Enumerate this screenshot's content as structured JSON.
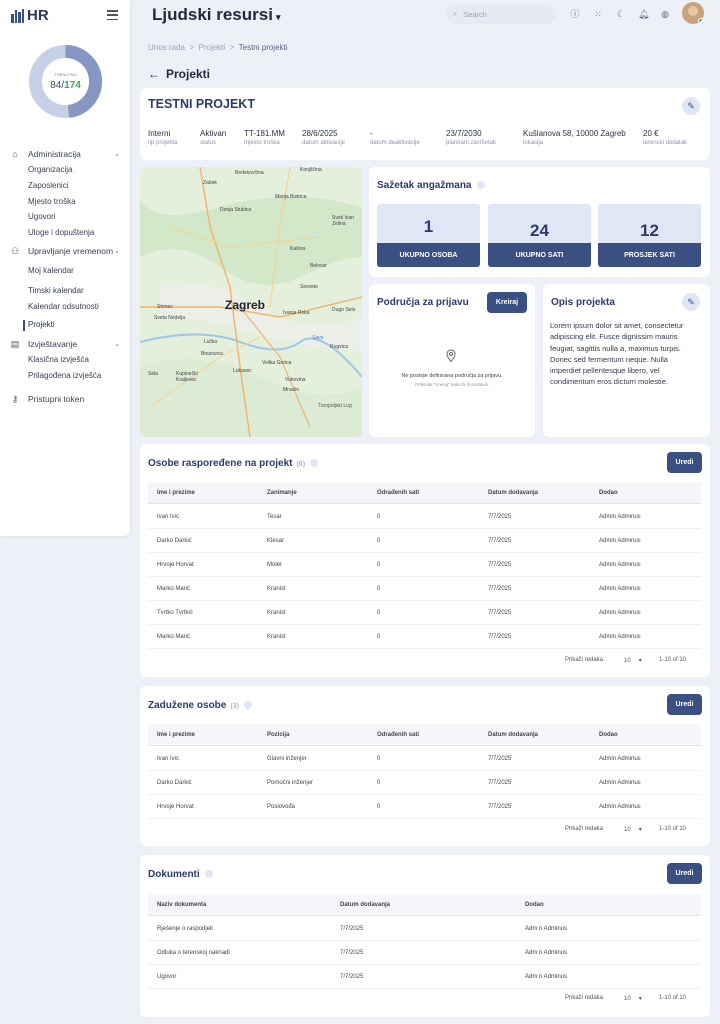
{
  "app": {
    "logo_text": "HR",
    "title": "Ljudski resursi",
    "title_caret": "▾"
  },
  "search": {
    "placeholder": "Search"
  },
  "donut": {
    "label": "TRENUTNO",
    "current": "84",
    "separator": "/",
    "total": "174"
  },
  "sidebar": {
    "sections": [
      {
        "label": "Administracija",
        "icon": "building-icon",
        "items": [
          "Organizacija",
          "Zaposlenici",
          "Mjesto troška",
          "Ugovori",
          "Uloge i dopuštenja"
        ]
      },
      {
        "label": "Upravljanje vremenom",
        "icon": "clock-people-icon",
        "items": [
          "Moj kalendar",
          "Timski kalendar",
          "Kalendar odsutnosti",
          "Projekti"
        ]
      },
      {
        "label": "Izvještavanje",
        "icon": "report-icon",
        "items": [
          "Klasična izvješća",
          "Prilagođena izvješća"
        ]
      }
    ],
    "token_label": "Pristupni token",
    "active_item": "Projekti"
  },
  "breadcrumb": {
    "item1": "Unos rada",
    "item2": "Projekti",
    "item3": "Testni projekti",
    "sep": ">"
  },
  "page": {
    "title": "Projekti",
    "back": "←"
  },
  "project": {
    "name": "TESTNI PROJEKT",
    "meta": [
      {
        "value": "Interni",
        "label": "tip projekta"
      },
      {
        "value": "Aktivan",
        "label": "status"
      },
      {
        "value": "TT-181.MM",
        "label": "mjesto troška"
      },
      {
        "value": "28/6/2025",
        "label": "datum aktivacije"
      },
      {
        "value": "-",
        "label": "datum deaktivacije"
      },
      {
        "value": "23/7/2030",
        "label": "planirani završetak"
      },
      {
        "value": "Kušlanova 58, 10000 Zagreb",
        "label": "lokacija"
      },
      {
        "value": "20 €",
        "label": "terenski dodatak"
      }
    ]
  },
  "map": {
    "city": "Zagreb",
    "labels": [
      "Bedekovčina",
      "Konjščina",
      "Zabok",
      "Marija Bistrica",
      "Donja Stubica",
      "Sveti Ivan Zelina",
      "Kašina",
      "Belovar",
      "Sesvete",
      "Dugo Selo",
      "Strmec",
      "Sveta Nedelja",
      "Lučko",
      "Brezovica",
      "Ivanja Reka",
      "Velika Gorica",
      "Rugvica",
      "Sela",
      "Kupinečki Kraljevec",
      "Lukavec",
      "Vukovina",
      "Mraclin",
      "Turopoljski Lug",
      "Sava"
    ]
  },
  "engagement": {
    "title": "Sažetak angažmana",
    "stats": [
      {
        "value": "1",
        "label": "UKUPNO OSOBA"
      },
      {
        "value": "24",
        "label": "UKUPNO SATI"
      },
      {
        "value": "12",
        "label": "PROSJEK SATI"
      }
    ]
  },
  "areas": {
    "title": "Područja za prijavu",
    "create_label": "Kreiraj",
    "empty_text": "Ne postoje definirana područja za prijavu.",
    "empty_hint": "Pritisnite \"Kreiraj\" kako bi ih postavili."
  },
  "description": {
    "title": "Opis projekta",
    "text": "Lorem ipsum dolor sit amet, consectetur adipiscing elit. Fusce dignissim mauris feugiat, sagittis nulla a, maximus turpis. Donec sed fermentum neque. Nulla imperdiet pellentesque libero, vel condimentum eros dictum molestie."
  },
  "assigned": {
    "title": "Osobe raspoređene na projekt",
    "count": "(6)",
    "edit_label": "Uredi",
    "headers": [
      "Ime i prezime",
      "Zanimanje",
      "Odrađenih sati",
      "Datum dodavanja",
      "Dodao"
    ],
    "rows": [
      [
        "Ivan Ivic",
        "Tesar",
        "0",
        "7/7/2025",
        "Admin Adminus"
      ],
      [
        "Darko Darkić",
        "Klesar",
        "0",
        "7/7/2025",
        "Admin Adminus"
      ],
      [
        "Hrvoje Horvat",
        "Moler",
        "0",
        "7/7/2025",
        "Admin Adminus"
      ],
      [
        "Marko Marić",
        "Kranist",
        "0",
        "7/7/2025",
        "Admin Adminus"
      ],
      [
        "Tvrtko Tvrtkić",
        "Kranist",
        "0",
        "7/7/2025",
        "Admin Adminus"
      ],
      [
        "Marko Marić",
        "Kranist",
        "0",
        "7/7/2025",
        "Admin Adminus"
      ]
    ],
    "rows_label": "Prikaži redaka",
    "rows_value": "10",
    "range": "1-10 of 10"
  },
  "responsible": {
    "title": "Zadužene osobe",
    "count": "(3)",
    "edit_label": "Uredi",
    "headers": [
      "Ime i prezime",
      "Pozicija",
      "Odrađenih sati",
      "Datum dodavanja",
      "Dodao"
    ],
    "rows": [
      [
        "Ivan Ivic",
        "Glavni inženjer",
        "0",
        "7/7/2025",
        "Admin Adminus"
      ],
      [
        "Darko Darkić",
        "Pomoćni inženjer",
        "0",
        "7/7/2025",
        "Admin Adminus"
      ],
      [
        "Hrvoje Horvat",
        "Poslovođa",
        "0",
        "7/7/2025",
        "Admin Adminus"
      ]
    ],
    "rows_label": "Prikaži redaka",
    "rows_value": "10",
    "range": "1-10 of 10"
  },
  "documents": {
    "title": "Dokumenti",
    "edit_label": "Uredi",
    "headers": [
      "Naziv dokumenta",
      "Datum dodavanja",
      "Dodao"
    ],
    "rows": [
      [
        "Rješenje o raspodjeli",
        "7/7/2025",
        "Adm n Adminus"
      ],
      [
        "Odluka o terenskoj naknadi",
        "7/7/2025",
        "Adm n Adminus"
      ],
      [
        "Ugovor",
        "7/7/2025",
        "Adm n Adminus"
      ]
    ],
    "rows_label": "Prikaži redaka",
    "rows_value": "10",
    "range": "1-10 of 10"
  },
  "colors": {
    "primary": "#3a4f82",
    "accent_light": "#dfe6f6",
    "success": "#3ba55d"
  }
}
